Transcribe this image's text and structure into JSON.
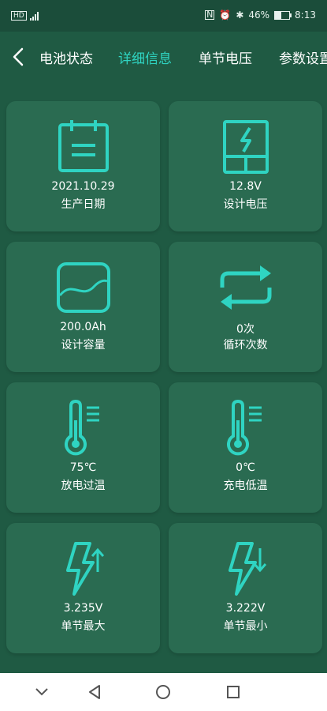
{
  "status_bar": {
    "left_badge": "HD",
    "right_text": "46%",
    "time": "8:13"
  },
  "nav": {
    "tabs": [
      {
        "label": "电池状态"
      },
      {
        "label": "详细信息"
      },
      {
        "label": "单节电压"
      },
      {
        "label": "参数设置"
      }
    ],
    "active_tab_index": 1
  },
  "cards": [
    {
      "icon": "calendar-icon",
      "value": "2021.10.29",
      "label": "生产日期"
    },
    {
      "icon": "battery-bolt-icon",
      "value": "12.8V",
      "label": "设计电压"
    },
    {
      "icon": "capacity-wave-icon",
      "value": "200.0Ah",
      "label": "设计容量"
    },
    {
      "icon": "cycle-arrows-icon",
      "value": "0次",
      "label": "循环次数"
    },
    {
      "icon": "thermometer-icon",
      "value": "75℃",
      "label": "放电过温"
    },
    {
      "icon": "thermometer-icon",
      "value": "0℃",
      "label": "充电低温"
    },
    {
      "icon": "bolt-up-icon",
      "value": "3.235V",
      "label": "单节最大"
    },
    {
      "icon": "bolt-down-icon",
      "value": "3.222V",
      "label": "单节最小"
    }
  ],
  "colors": {
    "background": "#1f5a43",
    "card": "#2a6b51",
    "accent": "#2fd4c2"
  }
}
